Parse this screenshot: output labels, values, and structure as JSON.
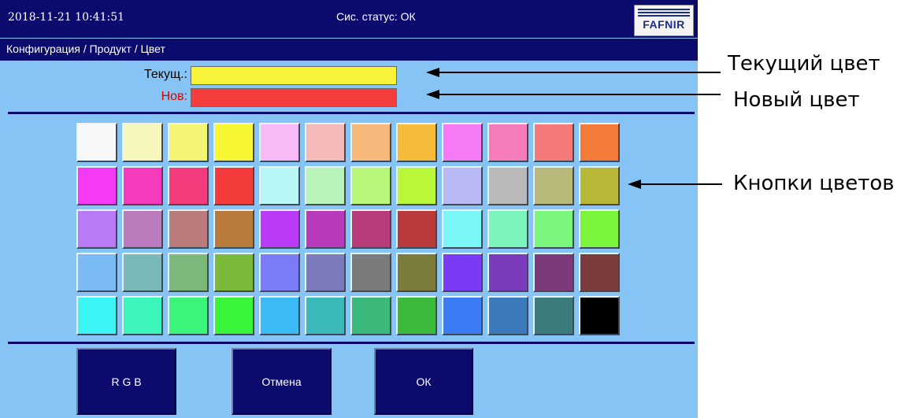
{
  "header": {
    "datetime": "2018-11-21  10:41:51",
    "status": "Сис. статус: ОК",
    "logo": "FAFNIR"
  },
  "breadcrumb": "Конфигурация / Продукт / Цвет",
  "color_preview": {
    "current_label": "Текущ.:",
    "current_color": "#f7f338",
    "new_label": "Нов:",
    "new_color": "#f53d3d"
  },
  "palette": [
    [
      "#f8f8f8",
      "#f7f7bd",
      "#f5f575",
      "#f6f635",
      "#f6baf6",
      "#f5b9b9",
      "#f6b97b",
      "#f7bb3a",
      "#f67af6",
      "#f57bbb",
      "#f47a7a",
      "#f47a3a"
    ],
    [
      "#f43af4",
      "#f53bbb",
      "#f43b7b",
      "#f33b3b",
      "#b9f6f6",
      "#b9f5b9",
      "#b9f77b",
      "#baf73b",
      "#b9b9f5",
      "#b9b9b9",
      "#b9b97b",
      "#b9b939"
    ],
    [
      "#b97af5",
      "#b97bbb",
      "#b97b7b",
      "#b97b3b",
      "#b93bf5",
      "#b93bbb",
      "#b93b7b",
      "#b93b3b",
      "#7af6f6",
      "#7bf5bb",
      "#7bf57b",
      "#7bf53b"
    ],
    [
      "#7bbbf5",
      "#7bb9b9",
      "#7bb97b",
      "#7bb93b",
      "#7b7bf5",
      "#7b7bbb",
      "#7b7b7b",
      "#7b7b3b",
      "#7b3bf5",
      "#7b3bbb",
      "#7b3b7b",
      "#7b3b3b"
    ],
    [
      "#3bf5f5",
      "#3bf5bb",
      "#3bf57b",
      "#3bf53b",
      "#3bbbf5",
      "#3bb9b9",
      "#3bb97b",
      "#3bb93b",
      "#3b7bf5",
      "#3b7bbb",
      "#3b7b7b",
      "#000000"
    ]
  ],
  "actions": {
    "rgb": "R G B",
    "cancel": "Отмена",
    "ok": "ОК"
  },
  "annotations": {
    "current_color": "Текущий цвет",
    "new_color": "Новый цвет",
    "color_buttons": "Кнопки цветов"
  },
  "colors": {
    "panel_background": "#85c4f4",
    "bar_navy": "#0b0b6e"
  }
}
